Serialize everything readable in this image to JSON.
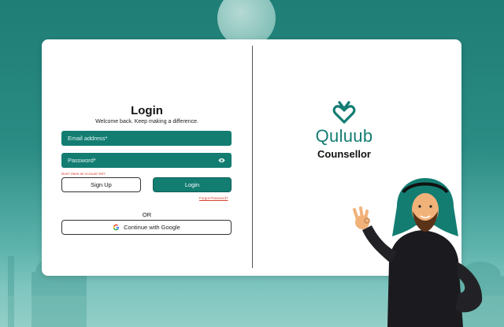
{
  "login": {
    "title": "Login",
    "subtitle": "Welcome back. Keep making a difference.",
    "email_placeholder": "Email address*",
    "password_placeholder": "Password*",
    "no_account_text": "Don't Have an Account Yet?",
    "signup_label": "Sign Up",
    "login_label": "Login",
    "forgot_label": "Forgot Password?",
    "or_label": "OR",
    "google_label": "Continue with Google"
  },
  "brand": {
    "name": "Quluub",
    "subtitle": "Counsellor",
    "accent_color": "#137d72"
  },
  "icons": {
    "eye": "eye-icon",
    "google": "google-icon",
    "logo": "quluub-logo-icon"
  }
}
